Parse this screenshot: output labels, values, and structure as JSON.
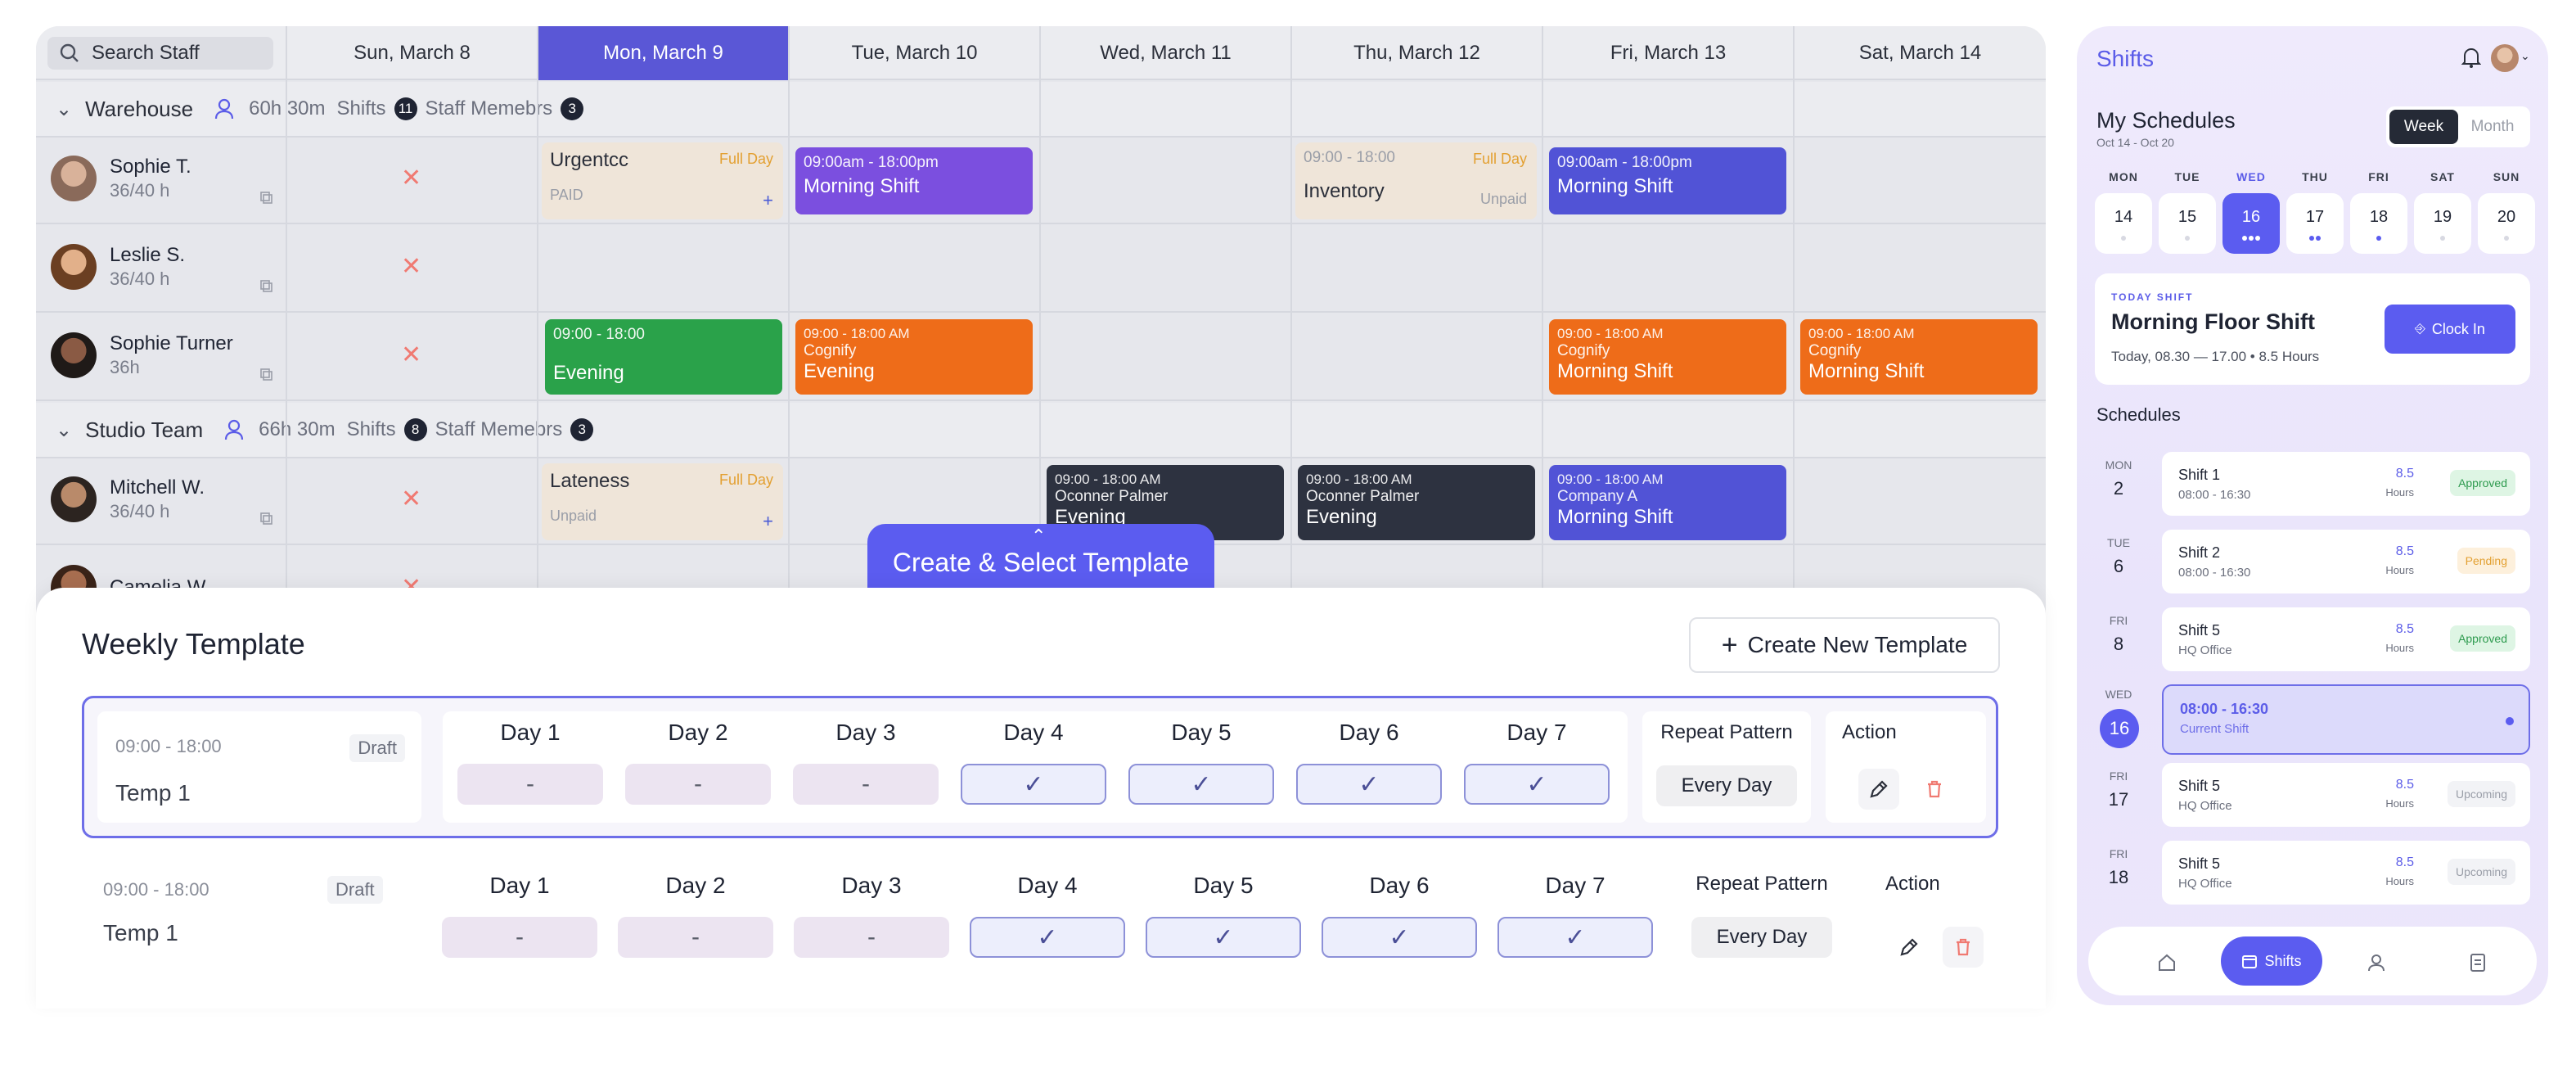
{
  "scheduler": {
    "search_placeholder": "Search Staff",
    "days": [
      "Sun, March 8",
      "Mon, March 9",
      "Tue, March 10",
      "Wed, March 11",
      "Thu, March 12",
      "Fri, March 13",
      "Sat, March 14"
    ],
    "active_day_index": 1,
    "groups": [
      {
        "name": "Warehouse",
        "hours": "60h 30m",
        "shifts_label": "Shifts",
        "shifts_count": "11",
        "members_label": "Staff Memebrs",
        "members_count": "3"
      },
      {
        "name": "Studio Team",
        "hours": "66h 30m",
        "shifts_label": "Shifts",
        "shifts_count": "8",
        "members_label": "Staff Memebrs",
        "members_count": "3"
      }
    ],
    "staff": [
      {
        "name": "Sophie T.",
        "hours": "36/40 h"
      },
      {
        "name": "Leslie S.",
        "hours": "36/40 h"
      },
      {
        "name": "Sophie Turner",
        "hours": "36h"
      },
      {
        "name": "Mitchell W.",
        "hours": "36/40 h"
      },
      {
        "name": "Camelia W.",
        "hours": ""
      }
    ],
    "cells": {
      "urgent": {
        "label": "Urgentcc",
        "tag": "Full Day",
        "sub": "PAID",
        "plus": "+"
      },
      "morning1": {
        "time": "09:00am - 18:00pm",
        "name": "Morning Shift"
      },
      "inventory": {
        "time": "09:00 - 18:00",
        "tag": "Full Day",
        "label": "Inventory",
        "sub": "Unpaid"
      },
      "morning2": {
        "time": "09:00am - 18:00pm",
        "name": "Morning Shift"
      },
      "evening_green": {
        "time": "09:00 - 18:00",
        "name": "Evening"
      },
      "cognify_evening": {
        "time": "09:00 - 18:00 AM",
        "company": "Cognify",
        "name": "Evening"
      },
      "cognify_morning_fri": {
        "time": "09:00 - 18:00 AM",
        "company": "Cognify",
        "name": "Morning Shift"
      },
      "cognify_morning_sat": {
        "time": "09:00 - 18:00 AM",
        "company": "Cognify",
        "name": "Morning Shift"
      },
      "lateness": {
        "label": "Lateness",
        "tag": "Full Day",
        "sub": "Unpaid",
        "plus": "+"
      },
      "oconner_wed": {
        "time": "09:00 - 18:00 AM",
        "company": "Oconner Palmer",
        "name": "Evening"
      },
      "oconner_thu": {
        "time": "09:00 - 18:00 AM",
        "company": "Oconner Palmer",
        "name": "Evening"
      },
      "companya": {
        "time": "09:00 - 18:00 AM",
        "company": "Company A",
        "name": "Morning Shift"
      }
    }
  },
  "template_panel": {
    "tab_label": "Create & Select Template",
    "title": "Weekly Template",
    "new_button": "Create New Template",
    "rows": [
      {
        "time": "09:00 - 18:00",
        "status": "Draft",
        "name": "Temp 1",
        "days": [
          "Day 1",
          "Day 2",
          "Day 3",
          "Day 4",
          "Day 5",
          "Day 6",
          "Day 7"
        ],
        "values": [
          "-",
          "-",
          "-",
          "✓",
          "✓",
          "✓",
          "✓"
        ],
        "repeat_label": "Repeat Pattern",
        "repeat_value": "Every Day",
        "action_label": "Action"
      },
      {
        "time": "09:00 - 18:00",
        "status": "Draft",
        "name": "Temp 1",
        "days": [
          "Day 1",
          "Day 2",
          "Day 3",
          "Day 4",
          "Day 5",
          "Day 6",
          "Day 7"
        ],
        "values": [
          "-",
          "-",
          "-",
          "✓",
          "✓",
          "✓",
          "✓"
        ],
        "repeat_label": "Repeat Pattern",
        "repeat_value": "Every Day",
        "action_label": "Action"
      }
    ]
  },
  "mobile": {
    "app_title": "Shifts",
    "heading": "My Schedules",
    "range": "Oct 14 - Oct 20",
    "view_options": [
      "Week",
      "Month"
    ],
    "weekdays": [
      "MON",
      "TUE",
      "WED",
      "THU",
      "FRI",
      "SAT",
      "SUN"
    ],
    "dates": [
      "14",
      "15",
      "16",
      "17",
      "18",
      "19",
      "20"
    ],
    "today_label": "TODAY SHIFT",
    "today_title": "Morning Floor Shift",
    "today_detail": "Today, 08.30 — 17.00 • 8.5 Hours",
    "clock_in": "Clock In",
    "schedules_label": "Schedules",
    "entries": [
      {
        "dow": "MON",
        "day": "2",
        "title": "Shift 1",
        "sub": "08:00 - 16:30",
        "hours": "8.5",
        "hours_label": "Hours",
        "status": "Approved"
      },
      {
        "dow": "TUE",
        "day": "6",
        "title": "Shift 2",
        "sub": "08:00 - 16:30",
        "hours": "8.5",
        "hours_label": "Hours",
        "status": "Pending"
      },
      {
        "dow": "FRI",
        "day": "8",
        "title": "Shift 5",
        "sub": "HQ Office",
        "hours": "8.5",
        "hours_label": "Hours",
        "status": "Approved"
      },
      {
        "dow": "WED",
        "day": "16",
        "title": "08:00 - 16:30",
        "sub": "Current Shift",
        "hours": "",
        "hours_label": "",
        "status": ""
      },
      {
        "dow": "FRI",
        "day": "17",
        "title": "Shift 5",
        "sub": "HQ Office",
        "hours": "8.5",
        "hours_label": "Hours",
        "status": "Upcoming"
      },
      {
        "dow": "FRI",
        "day": "18",
        "title": "Shift 5",
        "sub": "HQ Office",
        "hours": "8.5",
        "hours_label": "Hours",
        "status": "Upcoming"
      }
    ],
    "nav_active": "Shifts"
  }
}
